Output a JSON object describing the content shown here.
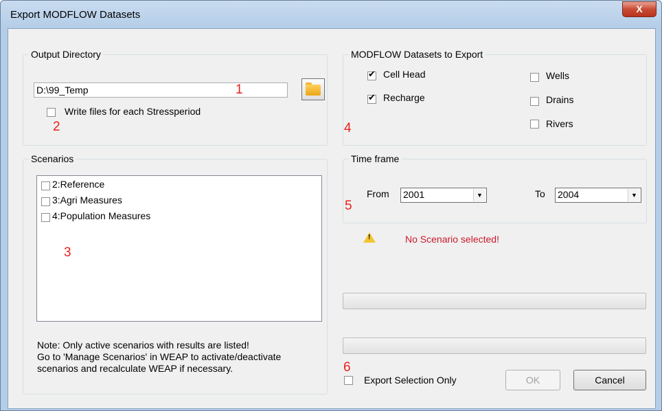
{
  "window": {
    "title": "Export MODFLOW Datasets",
    "close_glyph": "X"
  },
  "output_directory": {
    "label": "Output Directory",
    "path_value": "D:\\99_Temp",
    "browse_icon": "folder-icon",
    "write_each_stressperiod_label": "Write files for each Stressperiod",
    "write_each_stressperiod_checked": false
  },
  "datasets": {
    "label": "MODFLOW Datasets to Export",
    "items": [
      {
        "label": "Cell Head",
        "checked": true
      },
      {
        "label": "Recharge",
        "checked": true
      },
      {
        "label": "Wells",
        "checked": false
      },
      {
        "label": "Drains",
        "checked": false
      },
      {
        "label": "Rivers",
        "checked": false
      }
    ]
  },
  "scenarios": {
    "label": "Scenarios",
    "items": [
      {
        "label": "2:Reference",
        "checked": false
      },
      {
        "label": "3:Agri Measures",
        "checked": false
      },
      {
        "label": "4:Population Measures",
        "checked": false
      }
    ],
    "note_lines": [
      "Note: Only active scenarios with results are listed!",
      "Go to 'Manage Scenarios' in WEAP to activate/deactivate",
      "scenarios and recalculate WEAP if necessary."
    ]
  },
  "time_frame": {
    "label": "Time frame",
    "from_label": "From",
    "from_value": "2001",
    "to_label": "To",
    "to_value": "2004"
  },
  "status": {
    "warning_icon": "warning-icon",
    "message": "No Scenario selected!",
    "message_color": "#c8192c"
  },
  "export_selection_only": {
    "label": "Export Selection Only",
    "checked": false
  },
  "buttons": {
    "ok": "OK",
    "ok_enabled": false,
    "cancel": "Cancel"
  },
  "annotations": [
    "1",
    "2",
    "3",
    "4",
    "5",
    "6"
  ],
  "colors": {
    "annotation": "#e8211b",
    "dialog_bg": "#f0f0f0",
    "title_bar": "#b4cde8",
    "close_button": "#c94b35"
  }
}
